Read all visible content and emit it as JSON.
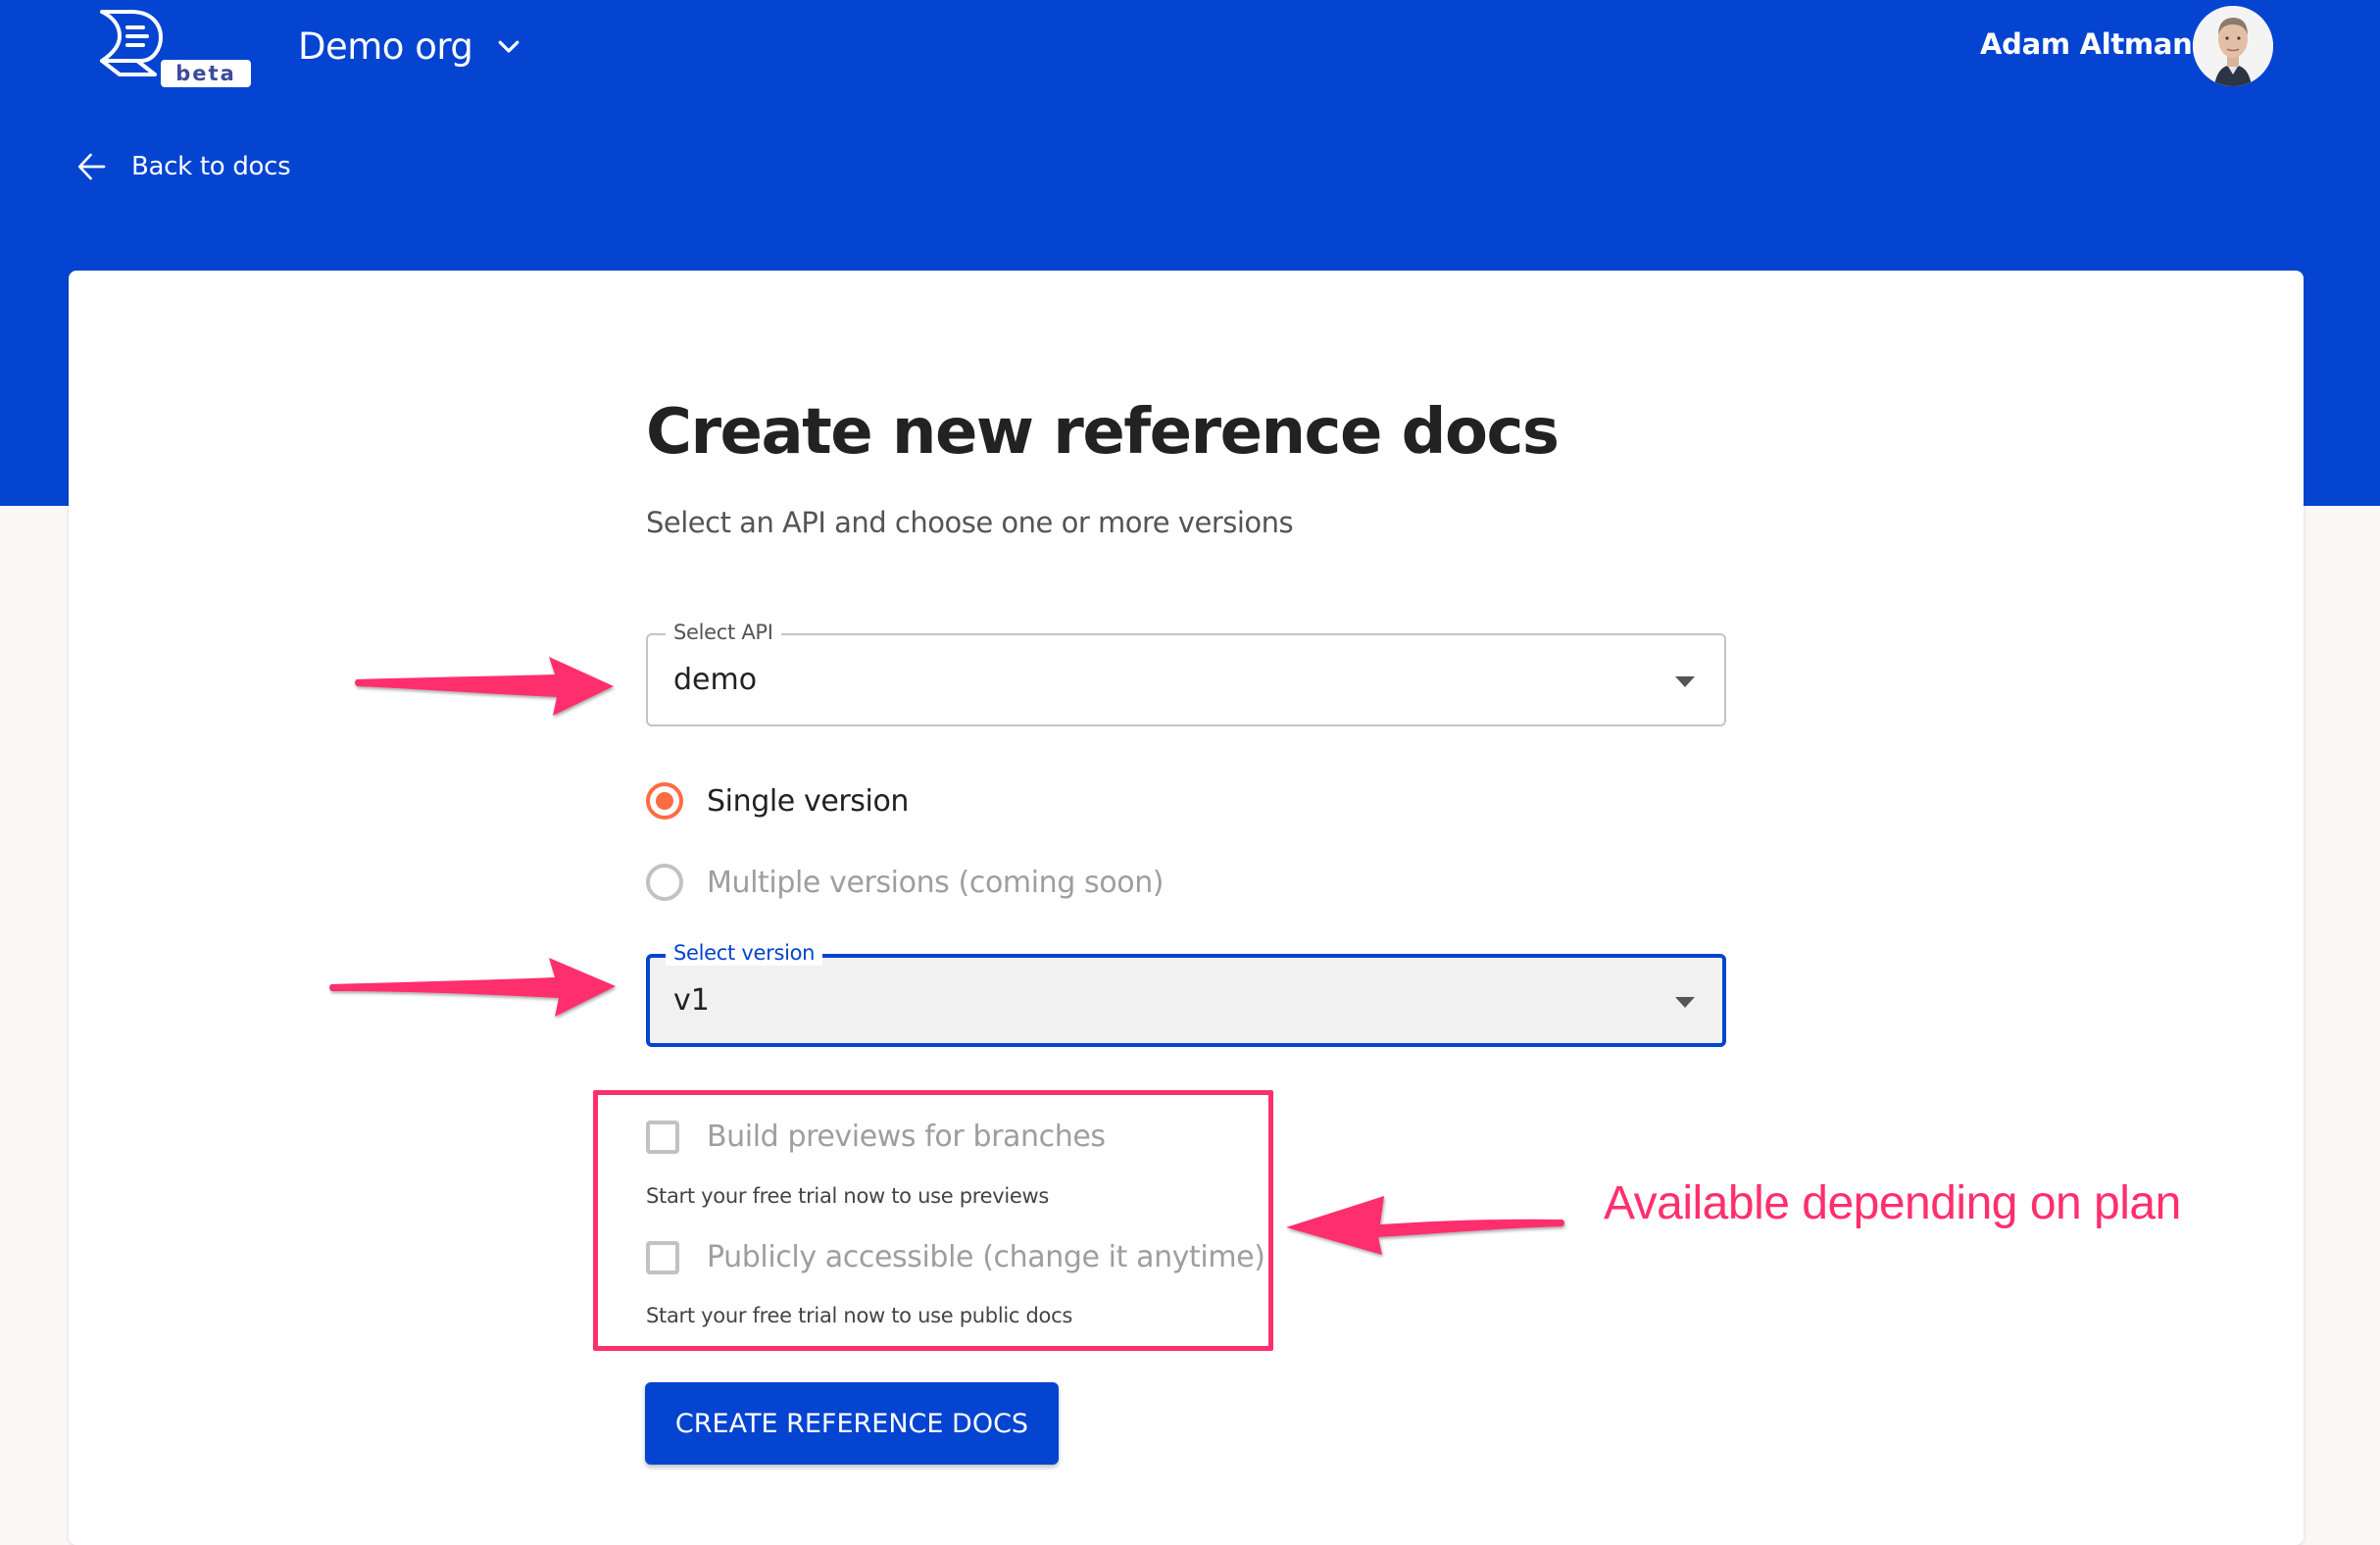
{
  "header": {
    "logo_badge": "beta",
    "org_name": "Demo org",
    "user_name": "Adam Altman",
    "back_link": "Back to docs"
  },
  "form": {
    "title": "Create new reference docs",
    "subtitle": "Select an API and choose one or more versions",
    "select_api": {
      "label": "Select API",
      "value": "demo"
    },
    "version_mode": {
      "options": [
        {
          "label": "Single version",
          "checked": true,
          "disabled": false
        },
        {
          "label": "Multiple versions (coming soon)",
          "checked": false,
          "disabled": true
        }
      ]
    },
    "select_version": {
      "label": "Select version",
      "value": "v1",
      "focused": true
    },
    "options": [
      {
        "label": "Build previews for branches",
        "checked": false,
        "disabled": true,
        "helper": "Start your free trial now to use previews"
      },
      {
        "label": "Publicly accessible (change it anytime)",
        "checked": false,
        "disabled": true,
        "helper": "Start your free trial now to use public docs"
      }
    ],
    "submit_label": "CREATE REFERENCE DOCS"
  },
  "annotations": {
    "plan_note": "Available depending on plan"
  },
  "colors": {
    "brand_blue": "#0444d1",
    "radio_accent": "#ff6b42",
    "annotation_pink": "#ff2f6d",
    "page_background": "#faf7f6"
  }
}
